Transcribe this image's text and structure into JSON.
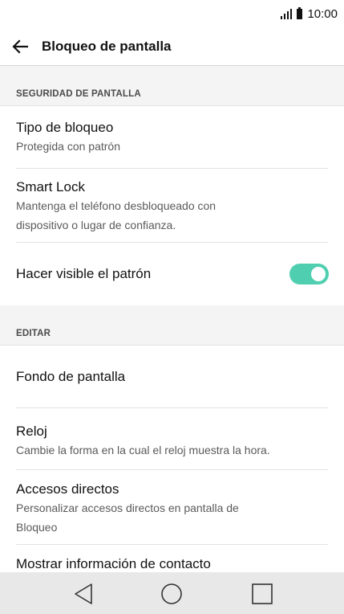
{
  "status_bar": {
    "time": "10:00",
    "signal_icon": "signal-bars-icon",
    "battery_icon": "battery-icon"
  },
  "app_bar": {
    "back_icon": "arrow-left-icon",
    "title": "Bloqueo de pantalla"
  },
  "sections": {
    "security": {
      "header": "SEGURIDAD DE PANTALLA",
      "items": {
        "lock_type": {
          "title": "Tipo de bloqueo",
          "subtitle": "Protegida con patrón"
        },
        "smart_lock": {
          "title": "Smart Lock",
          "subtitle_line1": "Mantenga el teléfono desbloqueado con",
          "subtitle_line2": "dispositivo o lugar de confianza."
        },
        "visible_pattern": {
          "title": "Hacer visible el patrón",
          "toggle_on": true
        }
      }
    },
    "edit": {
      "header": "EDITAR",
      "items": {
        "wallpaper": {
          "title": "Fondo de pantalla"
        },
        "clock": {
          "title": "Reloj",
          "subtitle": "Cambie la forma en la cual el reloj muestra la hora."
        },
        "shortcuts": {
          "title": "Accesos directos",
          "subtitle_line1": "Personalizar accesos directos en pantalla de",
          "subtitle_line2": "Bloqueo"
        },
        "contact_info": {
          "title": "Mostrar información de contacto"
        }
      }
    }
  },
  "nav_bar": {
    "back_icon": "nav-back-triangle-icon",
    "home_icon": "nav-home-circle-icon",
    "recents_icon": "nav-recents-square-icon"
  },
  "colors": {
    "toggle_on": "#4fcfb0",
    "section_bg": "#f4f4f4",
    "nav_bg": "#e8e8e8"
  }
}
